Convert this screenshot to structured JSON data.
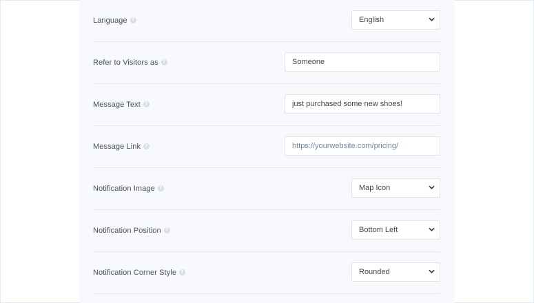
{
  "settings": {
    "language": {
      "label": "Language",
      "value": "English"
    },
    "refer_visitors": {
      "label": "Refer to Visitors as",
      "value": "Someone"
    },
    "message_text": {
      "label": "Message Text",
      "value": "just purchased some new shoes!"
    },
    "message_link": {
      "label": "Message Link",
      "placeholder": "https://yourwebsite.com/pricing/"
    },
    "notification_image": {
      "label": "Notification Image",
      "value": "Map Icon"
    },
    "notification_position": {
      "label": "Notification Position",
      "value": "Bottom Left"
    },
    "notification_corner_style": {
      "label": "Notification Corner Style",
      "value": "Rounded"
    }
  },
  "icons": {
    "help": "help-circle-icon",
    "dropdown": "chevron-down-icon"
  },
  "colors": {
    "panel_background": "#f8f9fc",
    "border": "#dfe3ea",
    "help_icon": "#d8dde6",
    "placeholder_text": "#6f87a5"
  }
}
